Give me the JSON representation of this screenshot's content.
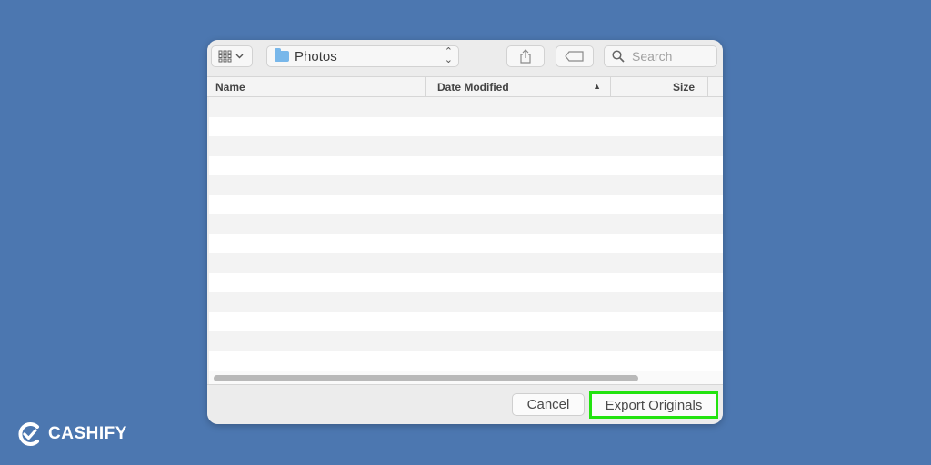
{
  "toolbar": {
    "view_icon": "grid-view-icon",
    "location": "Photos",
    "search_placeholder": "Search"
  },
  "columns": {
    "name": "Name",
    "date_modified": "Date Modified",
    "size": "Size"
  },
  "footer": {
    "cancel_label": "Cancel",
    "export_label": "Export Originals"
  },
  "brand": {
    "name": "CASHIFY"
  },
  "colors": {
    "background": "#4c77b0",
    "highlight": "#22e30f"
  }
}
